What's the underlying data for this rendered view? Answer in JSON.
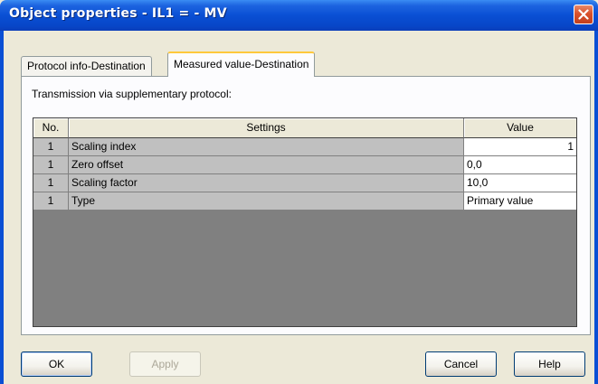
{
  "window": {
    "title": "Object properties - IL1 = - MV"
  },
  "tabs": [
    {
      "label": "Protocol info-Destination",
      "active": false
    },
    {
      "label": "Measured value-Destination",
      "active": true
    }
  ],
  "panel": {
    "section_label": "Transmission via supplementary protocol:"
  },
  "table": {
    "columns": [
      "No.",
      "Settings",
      "Value"
    ],
    "rows": [
      {
        "no": "1",
        "setting": "Scaling index",
        "value": "1"
      },
      {
        "no": "1",
        "setting": "Zero offset",
        "value": "0,0"
      },
      {
        "no": "1",
        "setting": "Scaling factor",
        "value": "10,0"
      },
      {
        "no": "1",
        "setting": "Type",
        "value": "Primary value"
      }
    ]
  },
  "buttons": {
    "ok": "OK",
    "apply": "Apply",
    "cancel": "Cancel",
    "help": "Help"
  },
  "icons": {
    "close": "close-icon"
  },
  "colors": {
    "titlebar": "#0a4fd4",
    "close_button": "#d9512c",
    "active_tab_accent": "#ffc83c",
    "grid_background": "#808080",
    "readonly_cell": "#c0c0c0"
  }
}
